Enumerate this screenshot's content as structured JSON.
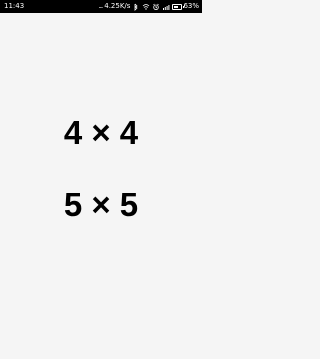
{
  "status_bar": {
    "time": "11:43",
    "network_speed": "4.25K/s",
    "battery_percent_text": "63%",
    "battery_level": 0.63,
    "icons": [
      "signal-dots-icon",
      "bluetooth-icon",
      "wifi-icon",
      "alarm-icon",
      "signal-bars-icon",
      "battery-icon"
    ]
  },
  "options": {
    "grid4_label": "4 × 4",
    "grid5_label": "5 × 5"
  },
  "colors": {
    "background": "#f5f5f5",
    "status_bar": "#000000",
    "text": "#000000"
  }
}
